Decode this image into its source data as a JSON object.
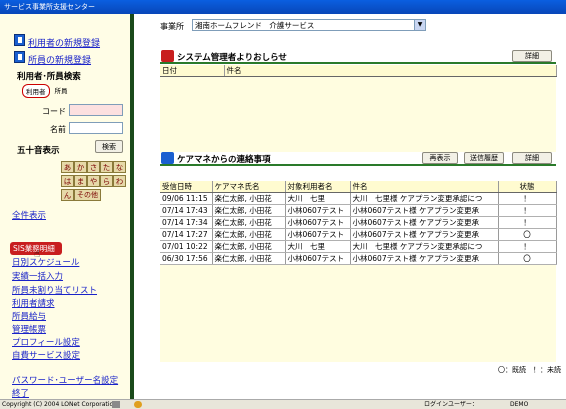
{
  "window": {
    "title": "サービス事業所支援センター"
  },
  "sidebar": {
    "register_user": "利用者の新規登録",
    "register_staff": "所員の新規登録",
    "search_heading": "利用者･所員検索",
    "radio_user": "利用者",
    "radio_staff": "所員",
    "code_label": "コード",
    "name_label": "名前",
    "kana_heading": "五十音表示",
    "search_button": "検索",
    "kana": [
      [
        "あ",
        "か",
        "さ",
        "た",
        "な"
      ],
      [
        "は",
        "ま",
        "や",
        "ら",
        "わ"
      ]
    ],
    "kana_n": "ん",
    "kana_other": "その他",
    "menu": {
      "all": "全件表示",
      "active": "SIS業務明細",
      "daily": "日別スケジュール",
      "bulk": "実績一括入力",
      "unassigned": "所員未割り当てリスト",
      "billing": "利用者請求",
      "salary": "所員給与",
      "management": "管理帳票",
      "profile": "プロフィール設定",
      "own_service": "自費サービス設定",
      "password": "パスワード･ユーザー名設定",
      "exit": "終了"
    }
  },
  "main": {
    "office_label": "事業所",
    "office_value": "湘南ホームフレンド　介護サービス",
    "admin_panel": {
      "title": "システム管理者よりおしらせ",
      "detail_button": "詳細",
      "headers": [
        "日付",
        "件名"
      ]
    },
    "caremgr_panel": {
      "title": "ケアマネからの連絡事項",
      "redisplay_button": "再表示",
      "history_button": "送信履歴",
      "detail_button": "詳細",
      "headers": [
        "受信日時",
        "ケアマネ氏名",
        "対象利用者名",
        "件名",
        "状態"
      ],
      "rows": [
        [
          "09/06 11:15",
          "楽仁太郎, 小田花",
          "大川　七里",
          "大川　七里様 ケアプラン変更承認につ",
          "！"
        ],
        [
          "07/14 17:43",
          "楽仁太郎, 小田花",
          "小林0607テスト",
          "小林0607テスト様 ケアプラン変更承",
          "！"
        ],
        [
          "07/14 17:34",
          "楽仁太郎, 小田花",
          "小林0607テスト",
          "小林0607テスト様 ケアプラン変更承",
          "！"
        ],
        [
          "07/14 17:27",
          "楽仁太郎, 小田花",
          "小林0607テスト",
          "小林0607テスト様 ケアプラン変更承",
          "〇"
        ],
        [
          "07/01 10:22",
          "楽仁太郎, 小田花",
          "大川　七里",
          "大川　七里様 ケアプラン変更承認につ",
          "！"
        ],
        [
          "06/30 17:56",
          "楽仁太郎, 小田花",
          "小林0607テスト",
          "小林0607テスト様 ケアプラン変更承",
          "〇"
        ]
      ]
    },
    "legend": "〇：既読　！：未読"
  },
  "statusbar": {
    "copyright": "Copyright (C) 2004 LONet Corporation",
    "login_label": "ログインユーザー：",
    "login_user": "DEMO"
  },
  "colors": {
    "accent_green": "#2a7a2a",
    "sidebar_bg": "#fffde6",
    "link": "#1a23c8"
  }
}
